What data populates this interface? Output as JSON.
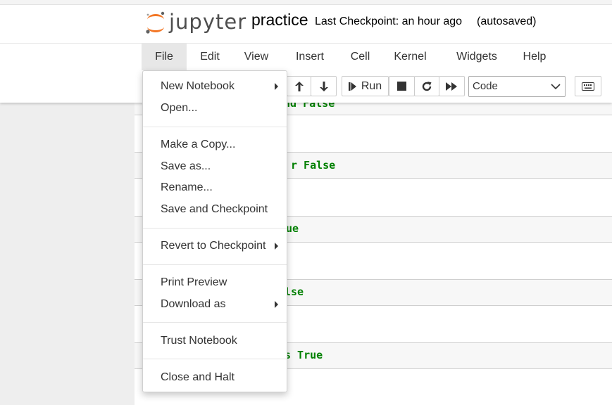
{
  "header": {
    "logo_text": "jupyter",
    "notebook_name": "practice",
    "checkpoint": "Last Checkpoint: an hour ago",
    "autosave": "(autosaved)"
  },
  "menubar": {
    "items": [
      "File",
      "Edit",
      "View",
      "Insert",
      "Cell",
      "Kernel",
      "Widgets",
      "Help"
    ]
  },
  "toolbar": {
    "run_label": "Run",
    "cell_type": "Code"
  },
  "file_menu": {
    "items": [
      {
        "label": "New Notebook"
      },
      {
        "label": "Open..."
      },
      {
        "label": "Make a Copy..."
      },
      {
        "label": "Save as..."
      },
      {
        "label": "Rename..."
      },
      {
        "label": "Save and Checkpoint"
      },
      {
        "label": "Revert to Checkpoint"
      },
      {
        "label": "Print Preview"
      },
      {
        "label": "Download as"
      },
      {
        "label": "Trust Notebook"
      },
      {
        "label": "Close and Halt"
      }
    ]
  },
  "cells": {
    "fragments": [
      "nd False",
      "r False",
      "rue",
      "lse",
      "s True"
    ]
  },
  "colors": {
    "keyword_green": "#008000",
    "logo_orange": "#f37726",
    "menu_active_bg": "#e7e7e7"
  }
}
